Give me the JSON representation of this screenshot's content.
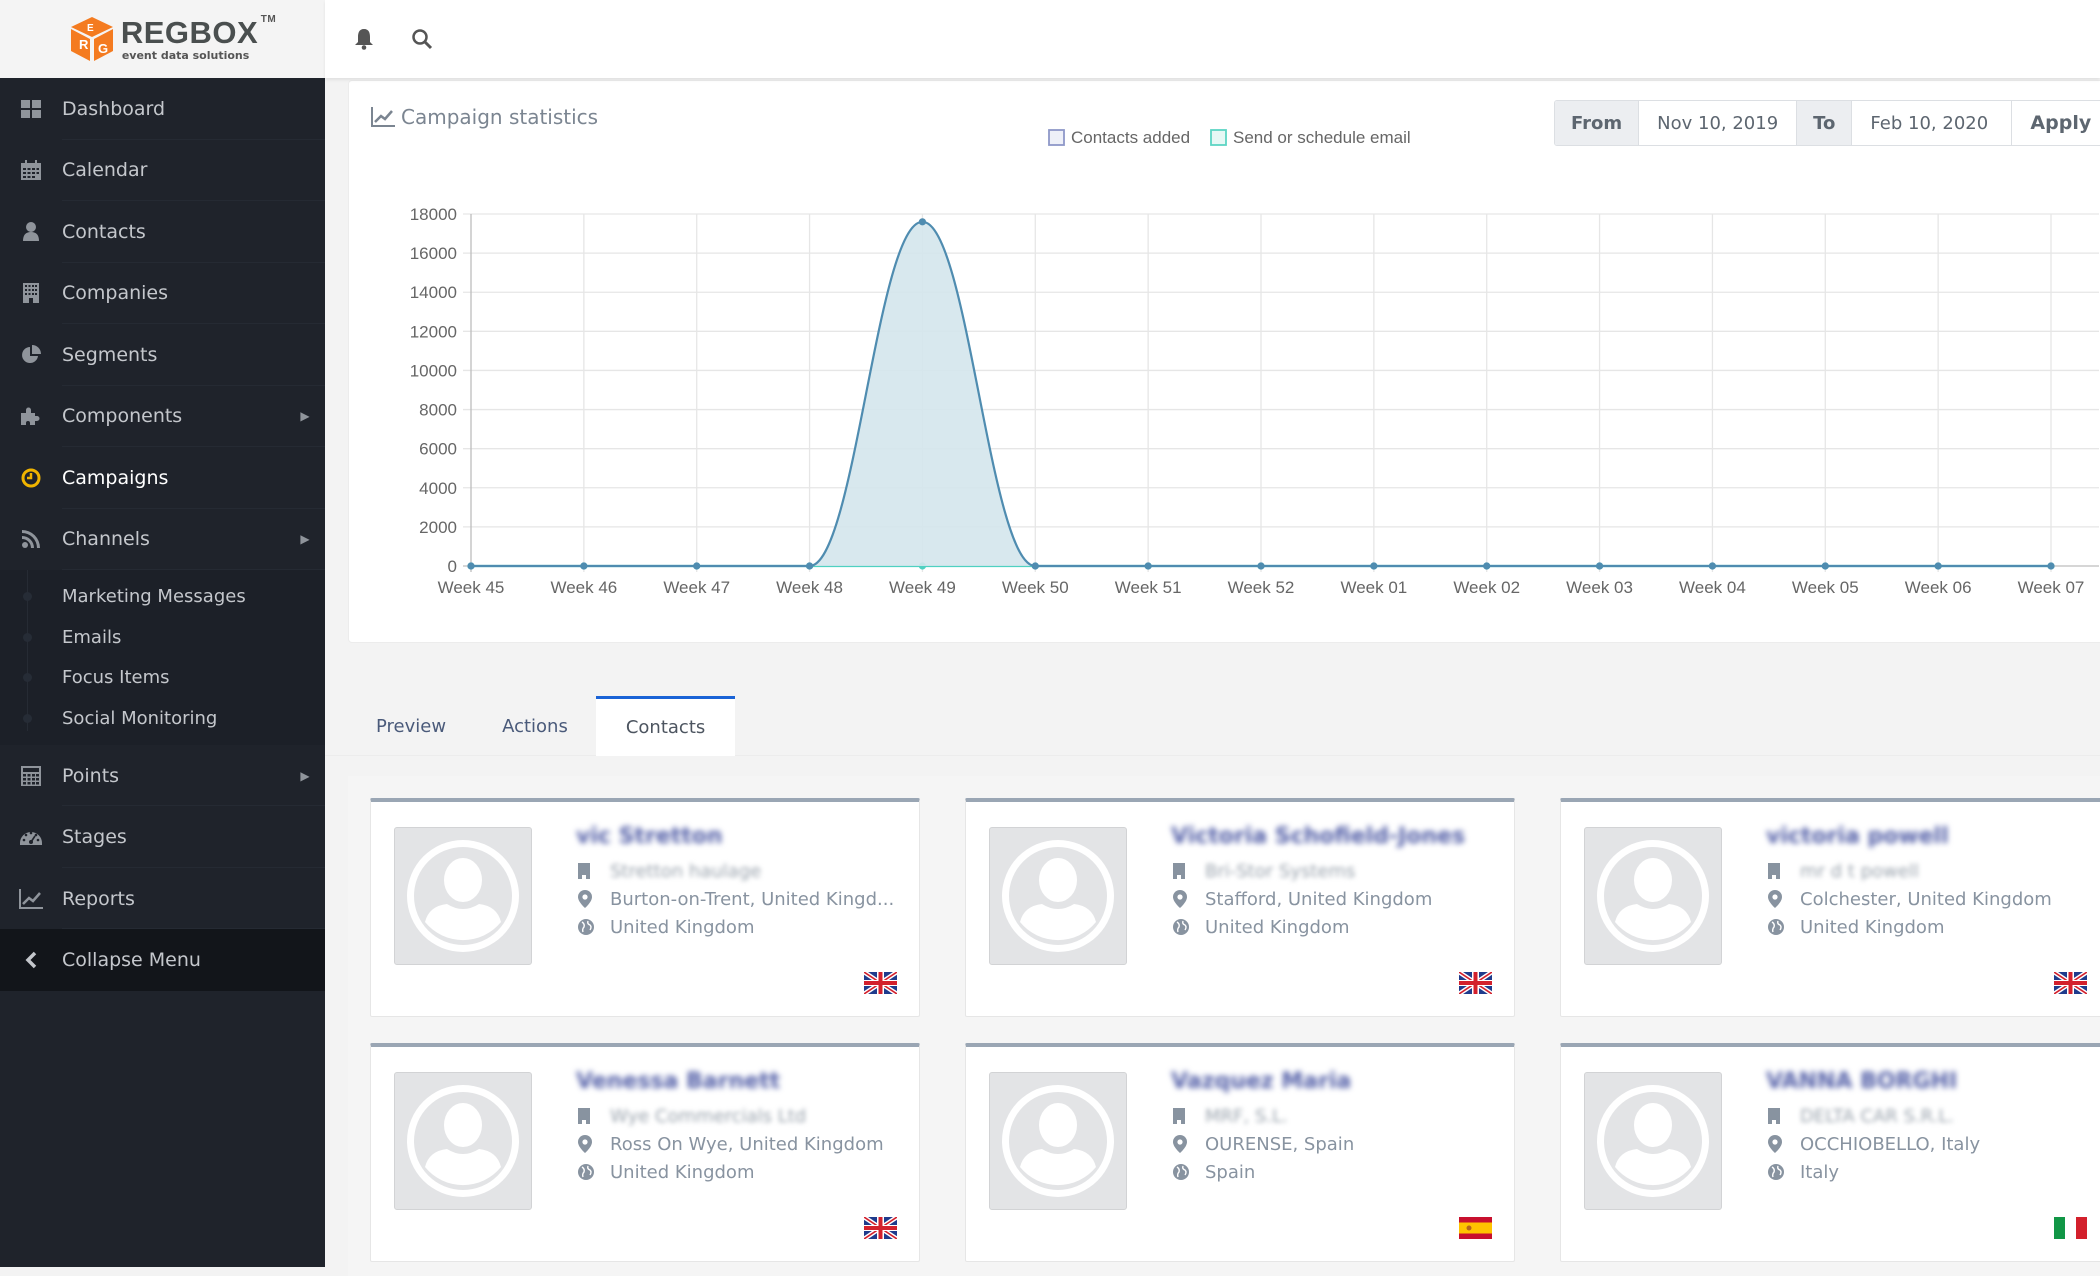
{
  "brand": {
    "name": "REGBOX",
    "tm": "TM",
    "tagline": "event data solutions",
    "accent": "#f47b20"
  },
  "topbar": {
    "icons": [
      "bell-icon",
      "search-icon"
    ]
  },
  "sidebar": {
    "items": [
      {
        "label": "Dashboard",
        "icon": "dashboard-icon"
      },
      {
        "label": "Calendar",
        "icon": "calendar-icon"
      },
      {
        "label": "Contacts",
        "icon": "user-icon"
      },
      {
        "label": "Companies",
        "icon": "building-icon"
      },
      {
        "label": "Segments",
        "icon": "pie-chart-icon"
      },
      {
        "label": "Components",
        "icon": "puzzle-icon",
        "has_submenu": true
      },
      {
        "label": "Campaigns",
        "icon": "clock-icon",
        "active": true
      },
      {
        "label": "Channels",
        "icon": "rss-icon",
        "has_submenu": true,
        "expanded": true
      },
      {
        "label": "Points",
        "icon": "calculator-icon",
        "has_submenu": true
      },
      {
        "label": "Stages",
        "icon": "tachometer-icon"
      },
      {
        "label": "Reports",
        "icon": "line-chart-icon"
      }
    ],
    "channels_submenu": [
      "Marketing Messages",
      "Emails",
      "Focus Items",
      "Social Monitoring"
    ],
    "collapse_label": "Collapse Menu",
    "active_color": "#f0b400"
  },
  "stats": {
    "title": "Campaign statistics",
    "date_range": {
      "from_label": "From",
      "from_value": "Nov 10, 2019",
      "to_label": "To",
      "to_value": "Feb 10, 2020",
      "apply_label": "Apply"
    }
  },
  "chart_data": {
    "type": "area",
    "title": "",
    "xlabel": "",
    "ylabel": "",
    "categories": [
      "Week 45",
      "Week 46",
      "Week 47",
      "Week 48",
      "Week 49",
      "Week 50",
      "Week 51",
      "Week 52",
      "Week 01",
      "Week 02",
      "Week 03",
      "Week 04",
      "Week 05",
      "Week 06",
      "Week 07"
    ],
    "series": [
      {
        "name": "Contacts added",
        "color": "#4f8cb0",
        "fill": "#d4e6ec",
        "values": [
          0,
          0,
          0,
          0,
          17600,
          0,
          0,
          0,
          0,
          0,
          0,
          0,
          0,
          0,
          0
        ]
      },
      {
        "name": "Send or schedule email",
        "color": "#4fd1c1",
        "fill": "#e2f6f4",
        "values": [
          0,
          0,
          0,
          0,
          0,
          0,
          0,
          0,
          0,
          0,
          0,
          0,
          0,
          0,
          0
        ]
      }
    ],
    "legend": [
      {
        "label": "Contacts added",
        "border": "#8e98c8",
        "fill": "#eef0f8"
      },
      {
        "label": "Send or schedule email",
        "border": "#5dd5c4",
        "fill": "#e6f8f5"
      }
    ],
    "yticks": [
      0,
      2000,
      4000,
      6000,
      8000,
      10000,
      12000,
      14000,
      16000,
      18000
    ],
    "ylim": [
      0,
      18000
    ],
    "grid": true,
    "legend_position": "top-center"
  },
  "tabs": [
    {
      "label": "Preview"
    },
    {
      "label": "Actions"
    },
    {
      "label": "Contacts",
      "active": true
    }
  ],
  "contacts": [
    {
      "name": "vic Stretton",
      "company": "Stretton haulage",
      "location": "Burton-on-Trent, United Kingd...",
      "country": "United Kingdom",
      "flag": "uk"
    },
    {
      "name": "Victoria Schofield-Jones",
      "company": "Bri-Stor Systems",
      "location": "Stafford, United Kingdom",
      "country": "United Kingdom",
      "flag": "uk"
    },
    {
      "name": "victoria powell",
      "company": "mr d t powell",
      "location": "Colchester, United Kingdom",
      "country": "United Kingdom",
      "flag": "uk"
    },
    {
      "name": "Venessa Barnett",
      "company": "Wye Commercials Ltd",
      "location": "Ross On Wye, United Kingdom",
      "country": "United Kingdom",
      "flag": "uk"
    },
    {
      "name": "Vazquez Maria",
      "company": "MRF, S.L.",
      "location": "OURENSE, Spain",
      "country": "Spain",
      "flag": "es"
    },
    {
      "name": "VANNA BORGHI",
      "company": "DELTA CAR S.R.L.",
      "location": "OCCHIOBELLO, Italy",
      "country": "Italy",
      "flag": "it"
    }
  ]
}
